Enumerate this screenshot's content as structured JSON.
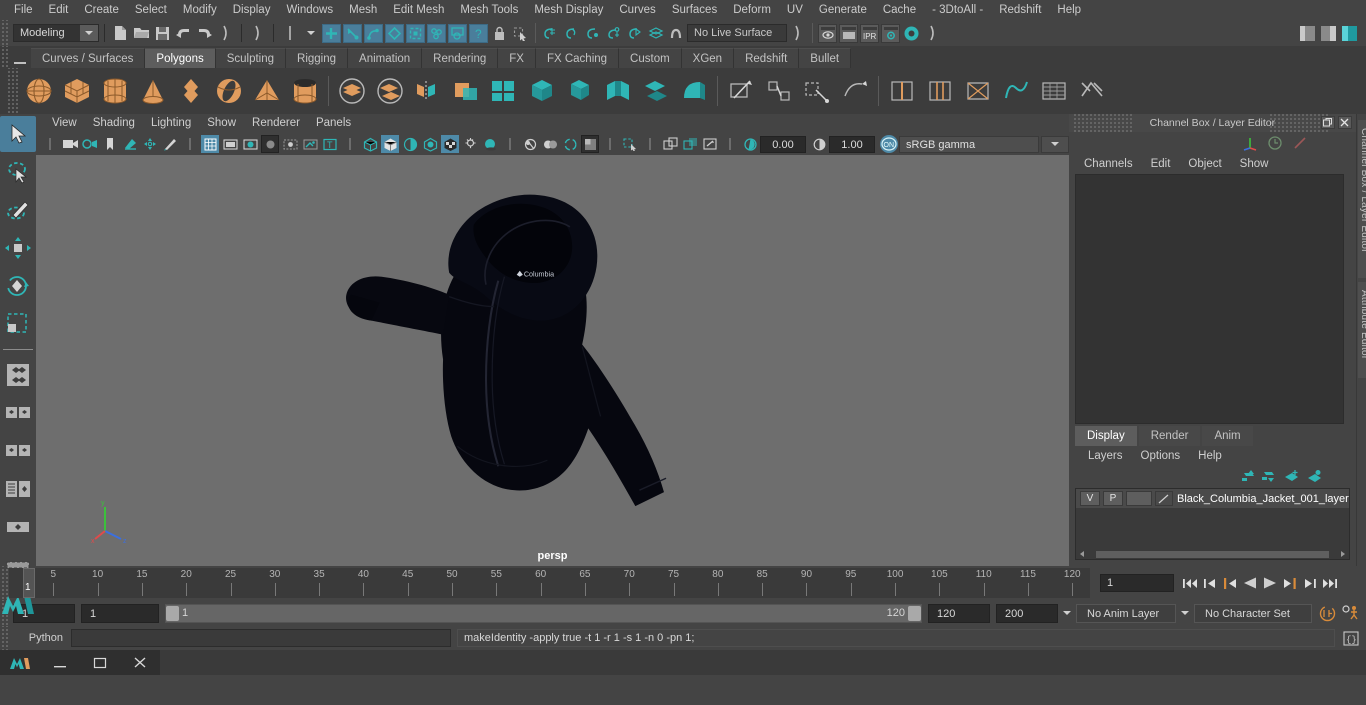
{
  "menubar": {
    "items": [
      "File",
      "Edit",
      "Create",
      "Select",
      "Modify",
      "Display",
      "Windows",
      "Mesh",
      "Edit Mesh",
      "Mesh Tools",
      "Mesh Display",
      "Curves",
      "Surfaces",
      "Deform",
      "UV",
      "Generate",
      "Cache",
      "- 3DtoAll -",
      "Redshift",
      "Help"
    ]
  },
  "statusline": {
    "mode_selector": "Modeling",
    "live_surface": "No Live Surface",
    "icons": [
      "new-scene-icon",
      "open-scene-icon",
      "save-scene-icon",
      "undo-icon",
      "redo-icon",
      "select-hierarchy-icon",
      "select-object-icon",
      "select-component-icon",
      "snap-grid-icon",
      "snap-curve-icon",
      "snap-point-icon",
      "snap-view-plane-icon",
      "snap-normal-icon",
      "make-live-icon",
      "render-view-icon",
      "render-current-frame-icon",
      "ipr-render-icon",
      "render-settings-icon",
      "hypershade-icon",
      "toggle-show-manipulator-icon"
    ],
    "ipr_label": "IPR"
  },
  "shelf": {
    "tabs": [
      "Curves / Surfaces",
      "Polygons",
      "Sculpting",
      "Rigging",
      "Animation",
      "Rendering",
      "FX",
      "FX Caching",
      "Custom",
      "XGen",
      "Redshift",
      "Bullet"
    ],
    "active_tab": "Polygons",
    "icons": [
      "poly-sphere-icon",
      "poly-cube-icon",
      "poly-cylinder-icon",
      "poly-cone-icon",
      "poly-platonic-icon",
      "poly-torus-icon",
      "poly-pyramid-icon",
      "poly-pipe-icon",
      "combine-icon",
      "separate-icon",
      "mirror-icon",
      "boolean-icon",
      "smooth-icon",
      "extrude-icon",
      "bevel-icon",
      "bridge-icon",
      "append-polygon-icon",
      "wedge-icon",
      "multicut-icon",
      "target-weld-icon",
      "quad-draw-icon",
      "sculpt-icon",
      "insert-edge-loop-icon",
      "offset-edge-loop-icon",
      "poke-icon",
      "connect-icon",
      "detach-icon",
      "crease-icon"
    ]
  },
  "toolbox": {
    "tools": [
      "select-tool",
      "lasso-select-tool",
      "paint-select-tool",
      "move-tool",
      "rotate-tool",
      "scale-tool",
      "last-tool-used",
      "four-view-layout",
      "two-pane-layout",
      "persp-outliner-layout",
      "persp-graph-layout",
      "hypershade-layout",
      "single-perspective-view",
      "maya-logo"
    ],
    "selected": "select-tool"
  },
  "viewport": {
    "menu": [
      "View",
      "Shading",
      "Lighting",
      "Show",
      "Renderer",
      "Panels"
    ],
    "camera_label": "persp",
    "exposure": "0.00",
    "gamma": "1.00",
    "color_space": "sRGB gamma",
    "toggle_on_label": "ON",
    "background_color": "#6e6e6e",
    "model_name": "Black_Columbia_Jacket_001",
    "model_color": "#05060f",
    "model_logo_text": "Columbia",
    "icons": [
      "select-camera-icon",
      "camera-attributes-icon",
      "bookmark-icon",
      "image-plane-icon",
      "two-d-pan-zoom-icon",
      "grease-pencil-icon",
      "grid-icon",
      "film-gate-icon",
      "resolution-gate-icon",
      "gate-mask-icon",
      "film-origin-icon",
      "xray-icon",
      "texture-border-icon",
      "wireframe-icon",
      "smooth-shade-icon",
      "shaded-wireframe-icon",
      "hardware-texture-icon",
      "light-shading-icon",
      "shadows-icon",
      "ambient-occlusion-icon",
      "motion-blur-icon",
      "multisample-icon",
      "depth-of-field-icon",
      "isolate-select-icon",
      "xray-joints-icon",
      "xray-active-icon",
      "exposure-icon",
      "gamma-icon",
      "view-transform-toggle-icon"
    ]
  },
  "right_panel": {
    "title": "Channel Box / Layer Editor",
    "menu": [
      "Channels",
      "Edit",
      "Object",
      "Show"
    ],
    "header_icons": [
      "axis-gizmo-icon",
      "clock-icon",
      "slash-icon"
    ],
    "window_buttons": [
      "undock-icon",
      "close-icon"
    ],
    "vertical_tabs": [
      "Channel Box / Layer Editor",
      "Attribute Editor"
    ],
    "layer_editor": {
      "tabs": [
        "Display",
        "Render",
        "Anim"
      ],
      "active_tab": "Display",
      "menu": [
        "Layers",
        "Options",
        "Help"
      ],
      "buttons": [
        "move-layer-up-icon",
        "move-layer-down-icon",
        "new-layer-icon",
        "new-layer-from-selected-icon"
      ],
      "layers": [
        {
          "visibility": "V",
          "playback": "P",
          "shading": "",
          "name": "Black_Columbia_Jacket_001_layer"
        }
      ]
    }
  },
  "timeline": {
    "ticks": [
      5,
      10,
      15,
      20,
      25,
      30,
      35,
      40,
      45,
      50,
      55,
      60,
      65,
      70,
      75,
      80,
      85,
      90,
      95,
      100,
      105,
      110,
      115,
      120
    ],
    "current_frame": "1",
    "current_frame_field": "1",
    "playback_buttons": [
      "go-to-start-icon",
      "step-back-keyframe-icon",
      "step-back-frame-icon",
      "play-backwards-icon",
      "play-forwards-icon",
      "step-forward-frame-icon",
      "step-forward-keyframe-icon",
      "go-to-end-icon"
    ]
  },
  "range_slider": {
    "anim_start": "1",
    "range_start": "1",
    "bar_start": "1",
    "bar_end": "120",
    "range_end": "120",
    "anim_end": "200",
    "anim_layer": "No Anim Layer",
    "character_set": "No Character Set",
    "right_icons": [
      "auto-keyframe-icon",
      "animation-preferences-icon"
    ]
  },
  "command_line": {
    "language_label": "Python",
    "input_value": "",
    "output_text": "makeIdentity -apply true -t 1 -r 1 -s 1 -n 0 -pn 1;",
    "script_editor_icon": "script-editor-icon"
  },
  "taskbar": {
    "icons": [
      "maya-app-icon",
      "minimize-icon",
      "maximize-icon",
      "close-icon"
    ]
  },
  "colors": {
    "accent_blue": "#4a7e9b",
    "shelf_orange": "#e09c5e",
    "teal": "#38b2b2",
    "panel_bg": "#444444",
    "viewport_bg": "#6e6e6e"
  }
}
